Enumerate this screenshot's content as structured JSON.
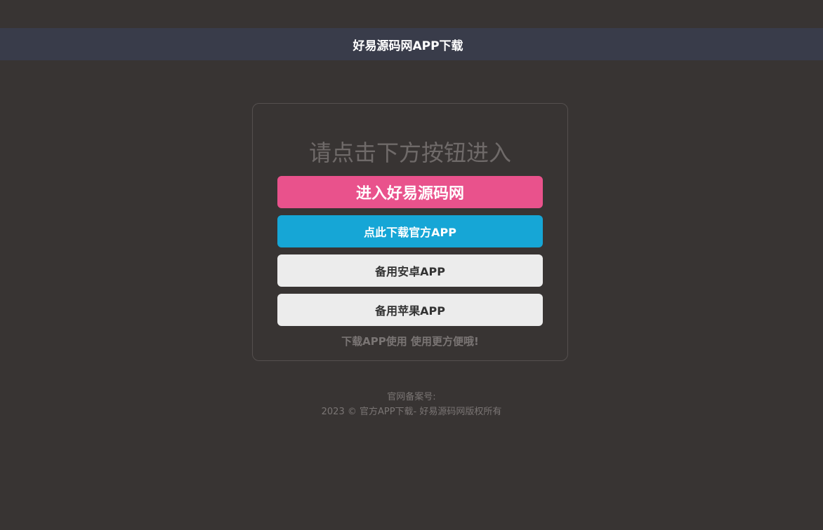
{
  "header": {
    "title": "好易源码网APP下载"
  },
  "card": {
    "prompt": "请点击下方按钮进入",
    "buttons": {
      "enter": "进入好易源码网",
      "download": "点此下载官方APP",
      "android": "备用安卓APP",
      "ios": "备用苹果APP"
    },
    "tip": "下载APP使用 使用更方便哦!"
  },
  "footer": {
    "record": "官网备案号:",
    "copyright": "2023 © 官方APP下载- 好易源码网版权所有"
  },
  "colors": {
    "background": "#383433",
    "header": "#393c4a",
    "enter_button": "#e9528c",
    "download_button": "#16a6d6",
    "backup_button": "#ececec"
  }
}
